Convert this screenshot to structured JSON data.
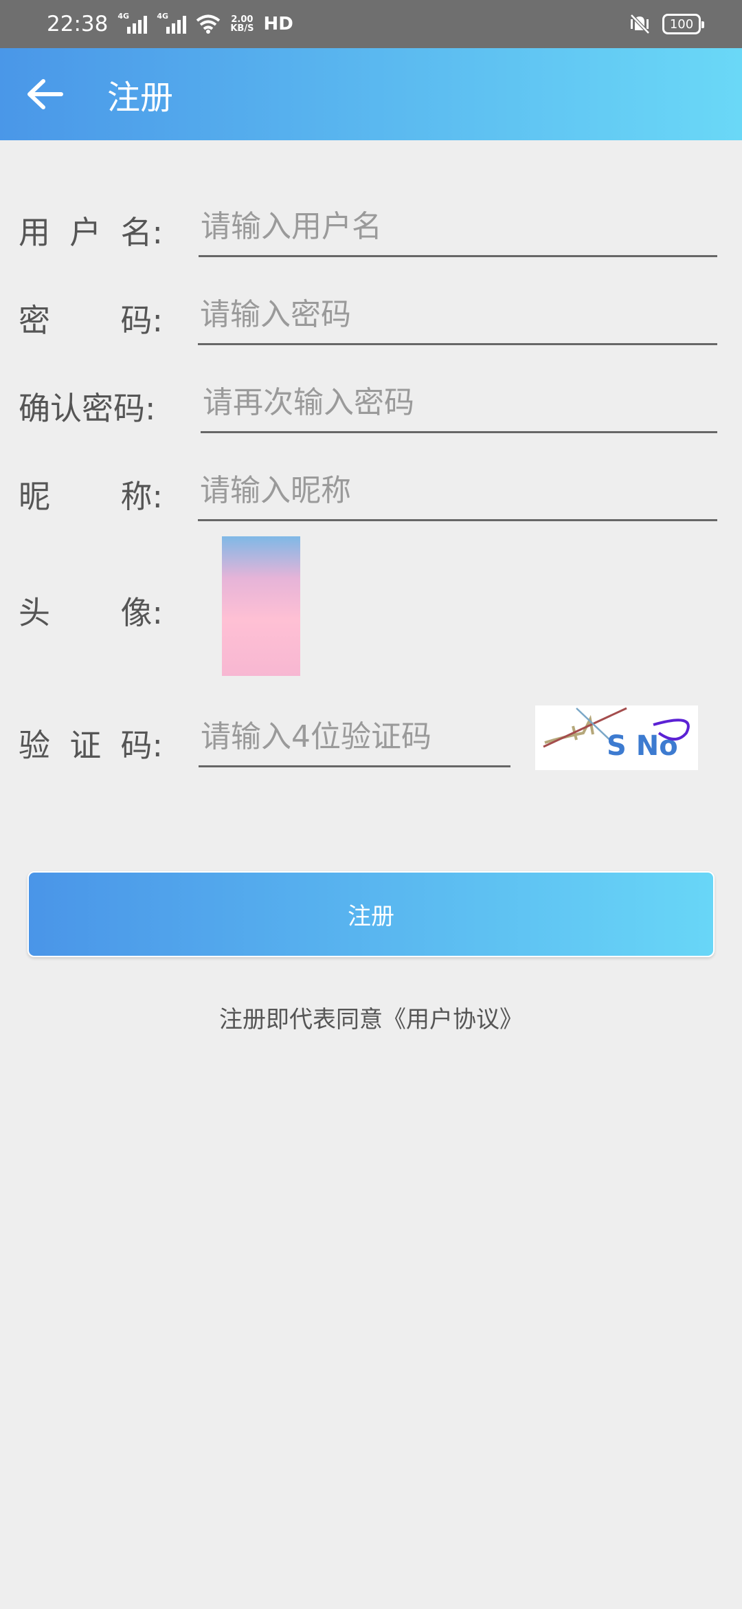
{
  "status_bar": {
    "time": "22:38",
    "network_1": "4G",
    "network_2": "4G",
    "speed_top": "2.00",
    "speed_bottom": "KB/S",
    "hd": "HD",
    "battery": "100"
  },
  "header": {
    "title": "注册"
  },
  "form": {
    "username": {
      "label": [
        "用",
        "户",
        "名:"
      ],
      "placeholder": "请输入用户名"
    },
    "password": {
      "label": [
        "密",
        "码:"
      ],
      "placeholder": "请输入密码"
    },
    "confirm_password": {
      "label": [
        "确认密码:"
      ],
      "placeholder": "请再次输入密码"
    },
    "nickname": {
      "label": [
        "昵",
        "称:"
      ],
      "placeholder": "请输入昵称"
    },
    "avatar": {
      "label": [
        "头",
        "像:"
      ]
    },
    "captcha": {
      "label": [
        "验",
        "证",
        "码:"
      ],
      "placeholder": "请输入4位验证码",
      "code_text": "S No"
    }
  },
  "submit_label": "注册",
  "agreement_text": "注册即代表同意《用户协议》",
  "colors": {
    "appbar_start": "#4a97e8",
    "appbar_end": "#6ad8f7"
  }
}
